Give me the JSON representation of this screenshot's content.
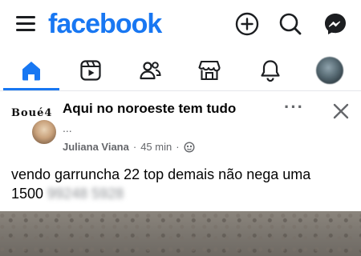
{
  "header": {
    "logo_text": "facebook",
    "brand_color": "#1877f2",
    "icons": [
      "menu-icon",
      "plus-icon",
      "search-icon",
      "messenger-icon"
    ]
  },
  "nav": {
    "tabs": [
      {
        "name": "home",
        "icon": "home-icon",
        "active": true
      },
      {
        "name": "video",
        "icon": "video-icon",
        "active": false
      },
      {
        "name": "friends",
        "icon": "friends-icon",
        "active": false
      },
      {
        "name": "marketplace",
        "icon": "marketplace-icon",
        "active": false
      },
      {
        "name": "notifications",
        "icon": "bell-icon",
        "active": false
      },
      {
        "name": "profile",
        "icon": "avatar",
        "active": false
      }
    ]
  },
  "post": {
    "thumb_text": "Boué4",
    "group_name": "Aqui no noroeste tem tudo",
    "ellipsis": "...",
    "author": "Juliana Viana",
    "separator": "·",
    "time": "45 min",
    "separator2": "·",
    "text_line1": "vendo garruncha 22 top demais não nega uma",
    "text_line2_prefix": "1500",
    "phone_blurred": "99248 5928"
  }
}
